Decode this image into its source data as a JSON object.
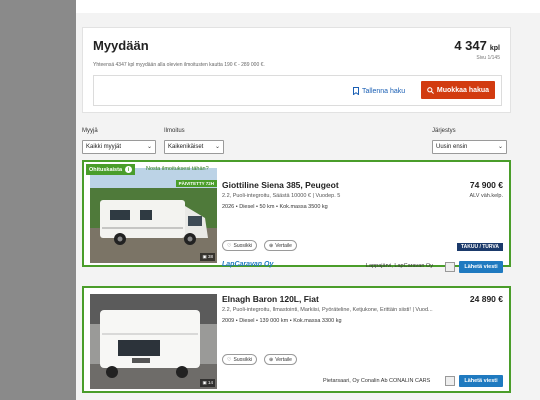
{
  "summary": {
    "title": "Myydään",
    "count": "4 347",
    "count_unit": "kpl",
    "page_info": "Sivu 1/145",
    "description": "Yhteensä 4347 kpl myydään alla olevien ilmoitusten kautta 190 € - 289 000 €.",
    "save_search": "Tallenna haku",
    "edit_search": "Muokkaa hakua"
  },
  "filters": {
    "seller_label": "Myyjä",
    "seller_value": "Kaikki myyjät",
    "listing_label": "Ilmoitus",
    "listing_value": "Kaikenikäiset",
    "sort_label": "Järjestys",
    "sort_value": "Uusin ensin"
  },
  "listings": [
    {
      "tag": "Ohituskaista",
      "promote": "Nosta ilmoituksesi tähän?",
      "updated_badge": "PÄIVITETTY 72H",
      "photo_count": "38",
      "title": "Giottiline Siena 385, Peugeot",
      "price": "74 900 €",
      "vat": "ALV väh.kelp.",
      "subtitle": "2.2, Puoli-integroitu, Säästä 10000 € | Vuodep. 5",
      "specs": "2026 • Diesel • 50 km • Kok.massa 3500 kg",
      "favorite": "Suosikki",
      "compare": "Vertaile",
      "guarantee": "TAKUU / TURVA",
      "dealer_logo": "LapCaravan Oy",
      "dealer": "Lappajärvi, LapCaravan Oy",
      "send": "Lähetä viesti"
    },
    {
      "photo_count": "14",
      "title": "Elnagh Baron 120L, Fiat",
      "price": "24 890 €",
      "subtitle": "2.2, Puoli-integroitu, Ilmastointi, Markiisi, Pyöräteline, Ketjukone, Erittäin siisti! | Vuod...",
      "specs": "2009 • Diesel • 139 000 km • Kok.massa 3300 kg",
      "favorite": "Suosikki",
      "compare": "Vertaile",
      "dealer": "Pietarsaari, Oy Conalin Ab CONALIN CARS",
      "send": "Lähetä viesti"
    }
  ],
  "colors": {
    "accent_green": "#4a9d2a",
    "edit_button": "#d23b10",
    "link_blue": "#1a5fb4",
    "send_button": "#1f7ac0"
  },
  "icons": [
    "bookmark-icon",
    "search-icon",
    "chevron-down-icon",
    "heart-icon",
    "plus-circle-icon",
    "info-icon",
    "camera-icon"
  ]
}
